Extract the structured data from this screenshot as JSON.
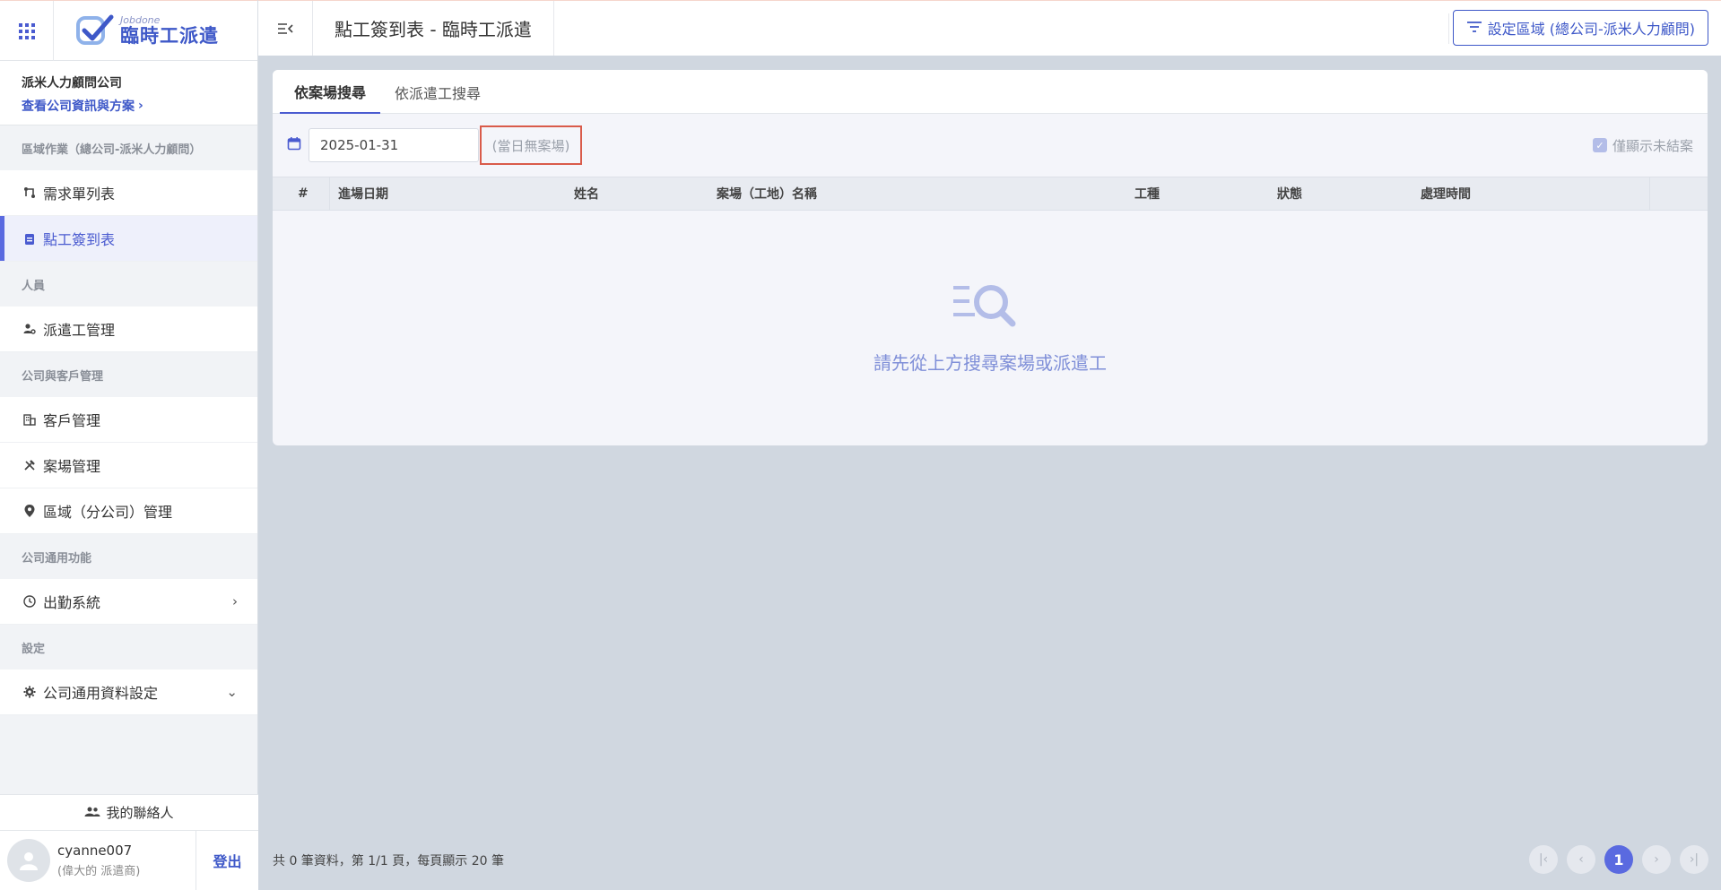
{
  "brand": {
    "small": "Jobdone",
    "name": "臨時工派遣"
  },
  "company": {
    "name": "派米人力顧問公司",
    "link": "查看公司資訊與方案"
  },
  "sidebar": {
    "sections": [
      {
        "title": "區域作業（總公司-派米人力顧問）"
      },
      {
        "title": "人員"
      },
      {
        "title": "公司與客戶管理"
      },
      {
        "title": "公司通用功能"
      },
      {
        "title": "設定"
      }
    ],
    "items": {
      "demand": "需求單列表",
      "attendance": "點工簽到表",
      "workers": "派遣工管理",
      "clients": "客戶管理",
      "sites": "案場管理",
      "regions": "區域（分公司）管理",
      "clock": "出勤系統",
      "settings": "公司通用資料設定"
    },
    "contacts": "我的聯絡人",
    "user": {
      "name": "cyanne007",
      "role": "(偉大的 派遣商)"
    },
    "logout": "登出"
  },
  "header": {
    "title": "點工簽到表 - 臨時工派遣",
    "region_button": "設定區域 (總公司-派米人力顧問)"
  },
  "tabs": [
    "依案場搜尋",
    "依派遣工搜尋"
  ],
  "filter": {
    "date": "2025-01-31",
    "no_site": "(當日無案場)",
    "only_open": "僅顯示未結案"
  },
  "table": {
    "headers": [
      "#",
      "進場日期",
      "姓名",
      "案場（工地）名稱",
      "工種",
      "狀態",
      "處理時間"
    ],
    "empty_message": "請先從上方搜尋案場或派遣工"
  },
  "footer": {
    "info": "共 0 筆資料，第 1/1 頁，每頁顯示 20 筆",
    "current_page": "1"
  },
  "colors": {
    "accent": "#4a5bd0",
    "highlight": "#d95b4a"
  }
}
